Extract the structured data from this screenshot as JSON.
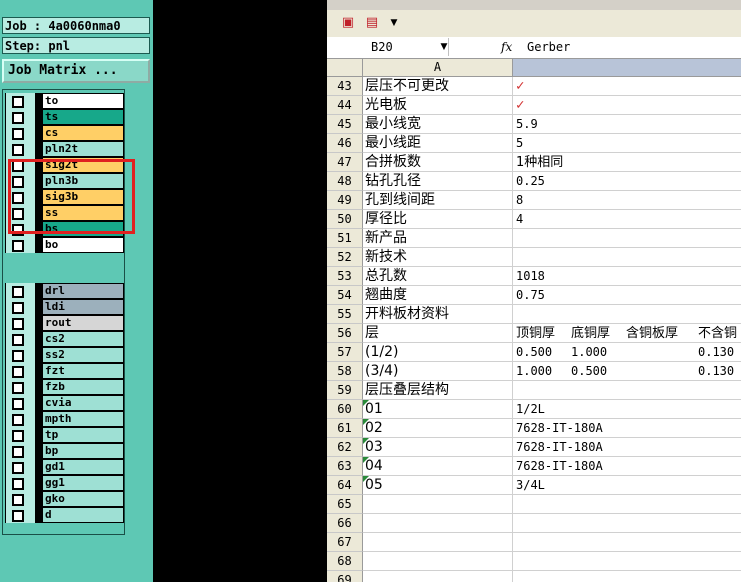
{
  "left_panel": {
    "job_label": "Job : 4a0060nma0",
    "step_label": "Step: pnl",
    "job_matrix_button": "Job Matrix ...",
    "layer_groups": [
      {
        "layers": [
          {
            "name": "to",
            "color": "#ffffff"
          },
          {
            "name": "ts",
            "color": "#17a88a"
          },
          {
            "name": "cs",
            "color": "#ffcf66"
          },
          {
            "name": "pln2t",
            "color": "#9ee0d4"
          },
          {
            "name": "sig2t",
            "color": "#ffcf66"
          },
          {
            "name": "pln3b",
            "color": "#9ee0d4"
          },
          {
            "name": "sig3b",
            "color": "#ffcf66"
          },
          {
            "name": "ss",
            "color": "#ffcf66"
          },
          {
            "name": "bs",
            "color": "#17a88a"
          },
          {
            "name": "bo",
            "color": "#ffffff"
          }
        ]
      },
      {
        "layers": [
          {
            "name": "drl",
            "color": "#9cb0bc"
          },
          {
            "name": "ldi",
            "color": "#9cb0bc"
          },
          {
            "name": "rout",
            "color": "#d6d6d6"
          }
        ]
      },
      {
        "layers": [
          {
            "name": "cs2",
            "color": "#9ee0d4"
          },
          {
            "name": "ss2",
            "color": "#9ee0d4"
          },
          {
            "name": "fzt",
            "color": "#9ee0d4"
          },
          {
            "name": "fzb",
            "color": "#9ee0d4"
          },
          {
            "name": "cvia",
            "color": "#9ee0d4"
          },
          {
            "name": "mpth",
            "color": "#9ee0d4"
          },
          {
            "name": "tp",
            "color": "#9ee0d4"
          },
          {
            "name": "bp",
            "color": "#9ee0d4"
          },
          {
            "name": "gd1",
            "color": "#9ee0d4"
          },
          {
            "name": "gg1",
            "color": "#9ee0d4"
          },
          {
            "name": "gko",
            "color": "#9ee0d4"
          },
          {
            "name": "d",
            "color": "#9ee0d4"
          }
        ]
      }
    ],
    "highlight_color": "#e02020"
  },
  "spreadsheet": {
    "name_box": "B20",
    "fx_label": "fx",
    "formula_value": "Gerber",
    "column_a_header": "A",
    "rows": [
      {
        "num": "43",
        "a": "层压不可更改",
        "b": "✓",
        "check": true
      },
      {
        "num": "44",
        "a": "光电板",
        "b": "✓",
        "check": true
      },
      {
        "num": "45",
        "a": "最小线宽",
        "b": "5.9"
      },
      {
        "num": "46",
        "a": "最小线距",
        "b": "5"
      },
      {
        "num": "47",
        "a": "合拼板数",
        "b": "1种相同",
        "cjk": true
      },
      {
        "num": "48",
        "a": "钻孔孔径",
        "b": "0.25"
      },
      {
        "num": "49",
        "a": "孔到线间距",
        "b": "8"
      },
      {
        "num": "50",
        "a": "厚径比",
        "b": "4"
      },
      {
        "num": "51",
        "a": "新产品",
        "b": ""
      },
      {
        "num": "52",
        "a": "新技术",
        "b": ""
      },
      {
        "num": "53",
        "a": "总孔数",
        "b": "1018"
      },
      {
        "num": "54",
        "a": "翘曲度",
        "b": "0.75"
      },
      {
        "num": "55",
        "a": "开料板材资料",
        "b": ""
      },
      {
        "num": "56",
        "a": "层",
        "b": "",
        "multi": [
          "顶铜厚",
          "底铜厚",
          "含铜板厚",
          "不含铜"
        ]
      },
      {
        "num": "57",
        "a": "(1/2)",
        "b": "",
        "multi": [
          "0.500",
          "1.000",
          "",
          "0.130"
        ]
      },
      {
        "num": "58",
        "a": "(3/4)",
        "b": "",
        "multi": [
          "1.000",
          "0.500",
          "",
          "0.130"
        ]
      },
      {
        "num": "59",
        "a": "层压叠层结构",
        "b": ""
      },
      {
        "num": "60",
        "a": "01",
        "b": "1/2L",
        "note": true
      },
      {
        "num": "61",
        "a": "02",
        "b": "7628-IT-180A",
        "note": true
      },
      {
        "num": "62",
        "a": "03",
        "b": "7628-IT-180A",
        "note": true
      },
      {
        "num": "63",
        "a": "04",
        "b": "7628-IT-180A",
        "note": true
      },
      {
        "num": "64",
        "a": "05",
        "b": "3/4L",
        "note": true
      },
      {
        "num": "65",
        "a": "",
        "b": ""
      },
      {
        "num": "66",
        "a": "",
        "b": ""
      },
      {
        "num": "67",
        "a": "",
        "b": ""
      },
      {
        "num": "68",
        "a": "",
        "b": ""
      },
      {
        "num": "69",
        "a": "",
        "b": ""
      }
    ]
  }
}
